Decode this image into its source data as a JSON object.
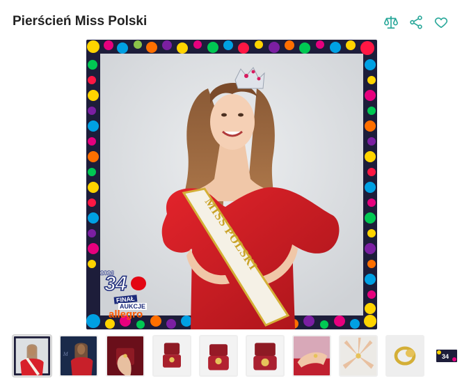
{
  "header": {
    "title": "Pierścień Miss Polski"
  },
  "actions": [
    {
      "icon": "compare-scales-icon"
    },
    {
      "icon": "share-icon"
    },
    {
      "icon": "heart-icon"
    }
  ],
  "accent_color": "#2aa89a",
  "main_image": {
    "sash_text": "MISS POLSKI",
    "overlay": {
      "year": "2026",
      "number": "34",
      "final": "FINAŁ",
      "aukcje": "AUKCJE",
      "allegro": "allegro"
    }
  },
  "thumbnails": [
    {
      "name": "thumb-1-miss-red-dress",
      "active": true
    },
    {
      "name": "thumb-2-miss-dark"
    },
    {
      "name": "thumb-3-ring-box-hand"
    },
    {
      "name": "thumb-4-ring-box-open"
    },
    {
      "name": "thumb-5-ring-box-red"
    },
    {
      "name": "thumb-6-ring-box-closeup"
    },
    {
      "name": "thumb-7-ring-on-finger"
    },
    {
      "name": "thumb-8-hands"
    },
    {
      "name": "thumb-9-signet-ring"
    },
    {
      "name": "thumb-10-wosp-logo"
    }
  ]
}
